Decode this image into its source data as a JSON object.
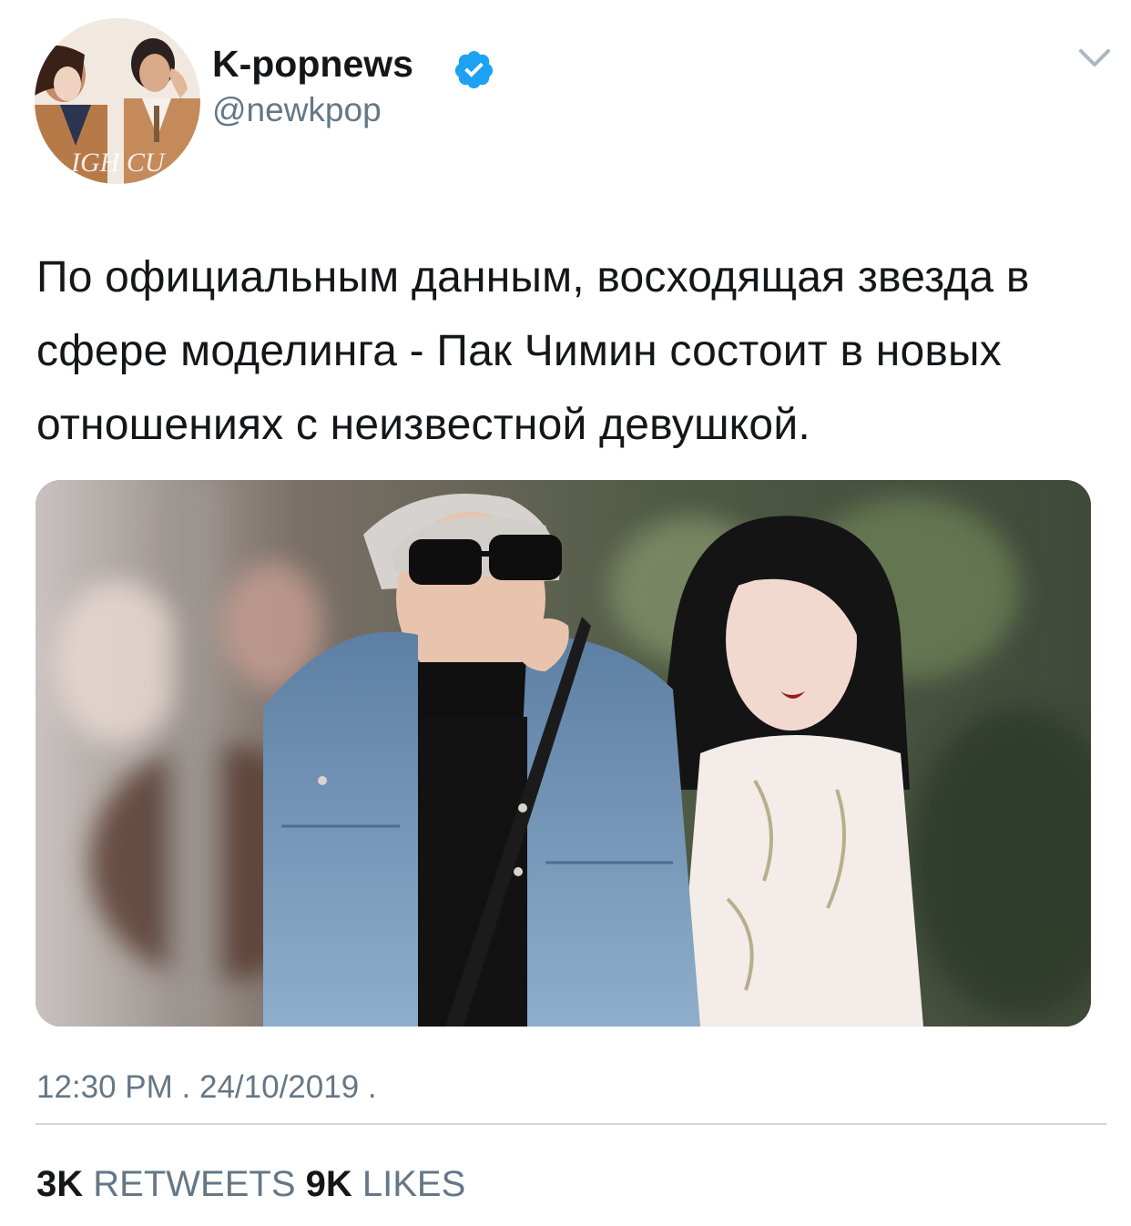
{
  "author": {
    "display_name": "K-popnews",
    "handle": "@newkpop",
    "verified": true,
    "avatar_watermark": "IGH CU"
  },
  "tweet": {
    "text": "По официальным данным, восходящая звезда в сфере моделинга - Пак Чимин состоит в новых отношениях с неизвестной девушкой.",
    "timestamp": "12:30 PM . 24/10/2019 ."
  },
  "stats": {
    "retweets_count": "3K",
    "retweets_label": "RETWEETS",
    "likes_count": "9K",
    "likes_label": "LIKES"
  },
  "colors": {
    "text_primary": "#14171a",
    "text_secondary": "#657786",
    "verified_blue": "#1da1f2",
    "divider": "#cfd6dc"
  },
  "icons": {
    "verified": "verified-badge-icon",
    "menu": "chevron-down-icon"
  }
}
